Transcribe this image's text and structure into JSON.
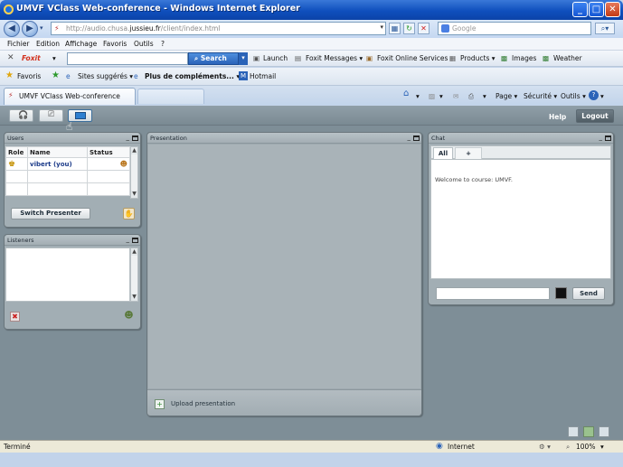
{
  "window": {
    "title": "UMVF VClass Web-conference - Windows Internet Explorer",
    "controls": [
      "_",
      "□",
      "✕"
    ]
  },
  "address_bar": {
    "url_pre": "http://audio.chusa.",
    "url_domain": "jussieu.fr",
    "url_post": "/client/index.html",
    "search_placeholder": "Google"
  },
  "menu": [
    "Fichier",
    "Edition",
    "Affichage",
    "Favoris",
    "Outils",
    "?"
  ],
  "foxit_toolbar": {
    "brand": "Foxit",
    "search_button": "Search",
    "items": [
      {
        "label": "Launch"
      },
      {
        "label": "Foxit Messages",
        "dropdown": true
      },
      {
        "label": "Foxit Online Services"
      },
      {
        "label": "Products",
        "dropdown": true
      },
      {
        "label": "Images"
      },
      {
        "label": "Weather"
      }
    ]
  },
  "favorites_bar": {
    "favorites_label": "Favoris",
    "items": [
      "Sites suggérés ▾",
      "Plus de compléments... ▾",
      "Hotmail"
    ]
  },
  "tab": {
    "title": "UMVF VClass Web-conference"
  },
  "command_bar": {
    "page": "Page",
    "security": "Sécurité",
    "tools": "Outils"
  },
  "app": {
    "help": "Help",
    "logout": "Logout",
    "users_panel": {
      "title": "Users",
      "columns": [
        "Role",
        "Name",
        "Status"
      ],
      "rows": [
        {
          "name": "vibert (you)"
        }
      ],
      "switch_presenter": "Switch Presenter"
    },
    "listeners_panel": {
      "title": "Listeners"
    },
    "presentation_panel": {
      "title": "Presentation",
      "upload": "Upload presentation"
    },
    "chat_panel": {
      "title": "Chat",
      "tab_all": "All",
      "tab_add": "+",
      "welcome": "Welcome to course: UMVF.",
      "send": "Send"
    }
  },
  "status_bar": {
    "status": "Terminé",
    "zone": "Internet",
    "zoom": "100%"
  }
}
